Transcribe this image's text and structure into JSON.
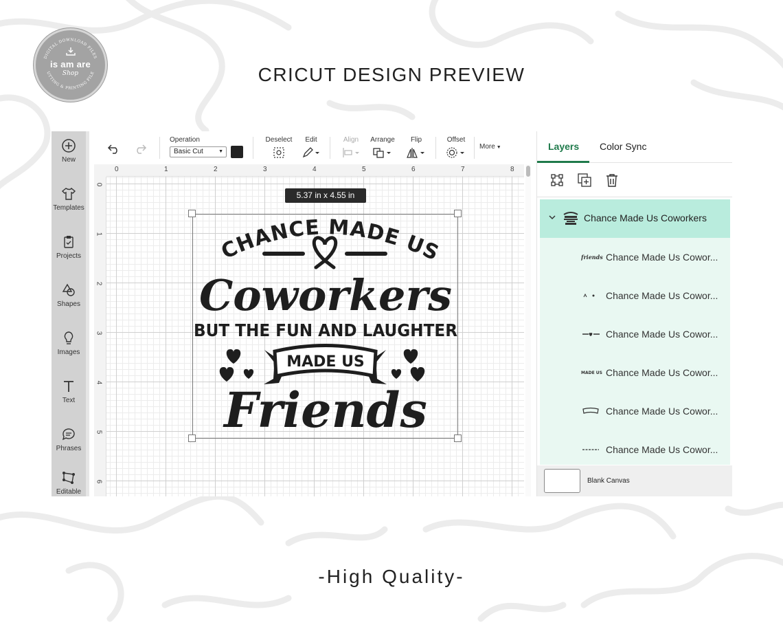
{
  "page": {
    "title": "CRICUT DESIGN PREVIEW",
    "footer": "-High Quality-",
    "badge": {
      "name": "is am are",
      "sub": "Shop",
      "arc_top": "DIGITAL DOWNLOAD FILES",
      "arc_bottom": "CUTTING & PRINTING FILES"
    }
  },
  "sidebar": {
    "items": [
      {
        "label": "New",
        "icon": "plus-circle-icon"
      },
      {
        "label": "Templates",
        "icon": "tshirt-icon"
      },
      {
        "label": "Projects",
        "icon": "clipboard-icon"
      },
      {
        "label": "Shapes",
        "icon": "shapes-icon"
      },
      {
        "label": "Images",
        "icon": "lightbulb-icon"
      },
      {
        "label": "Text",
        "icon": "text-icon"
      },
      {
        "label": "Phrases",
        "icon": "speech-bubble-icon"
      },
      {
        "label": "Editable",
        "icon": "editable-icon"
      }
    ]
  },
  "toolbar": {
    "operation_label": "Operation",
    "operation_value": "Basic Cut",
    "deselect_label": "Deselect",
    "edit_label": "Edit",
    "align_label": "Align",
    "arrange_label": "Arrange",
    "flip_label": "Flip",
    "offset_label": "Offset",
    "more_label": "More",
    "swatch_color": "#222222"
  },
  "canvas": {
    "ruler_top": [
      "0",
      "1",
      "2",
      "3",
      "4",
      "5",
      "6",
      "7",
      "8"
    ],
    "ruler_left": [
      "0",
      "1",
      "2",
      "3",
      "4",
      "5",
      "6"
    ],
    "dimensions": "5.37  in x 4.55  in",
    "design_lines": [
      "CHANCE MADE US",
      "Coworkers",
      "BUT THE FUN AND LAUGHTER",
      "MADE US",
      "Friends"
    ]
  },
  "panel": {
    "tabs": [
      {
        "label": "Layers",
        "active": true
      },
      {
        "label": "Color Sync",
        "active": false
      }
    ],
    "group_name": "Chance Made Us Coworkers",
    "children": [
      {
        "name": "Chance Made Us Cowor...",
        "thumb_text": "friends"
      },
      {
        "name": "Chance Made Us Cowor...",
        "thumb_text": ""
      },
      {
        "name": "Chance Made Us Cowor...",
        "thumb_text": ""
      },
      {
        "name": "Chance Made Us Cowor...",
        "thumb_text": "MADE US"
      },
      {
        "name": "Chance Made Us Cowor...",
        "thumb_text": ""
      },
      {
        "name": "Chance Made Us Cowor...",
        "thumb_text": ""
      }
    ],
    "blank_canvas": "Blank Canvas",
    "accent": "#1f7a4b",
    "group_bg": "#b9ecdd"
  }
}
